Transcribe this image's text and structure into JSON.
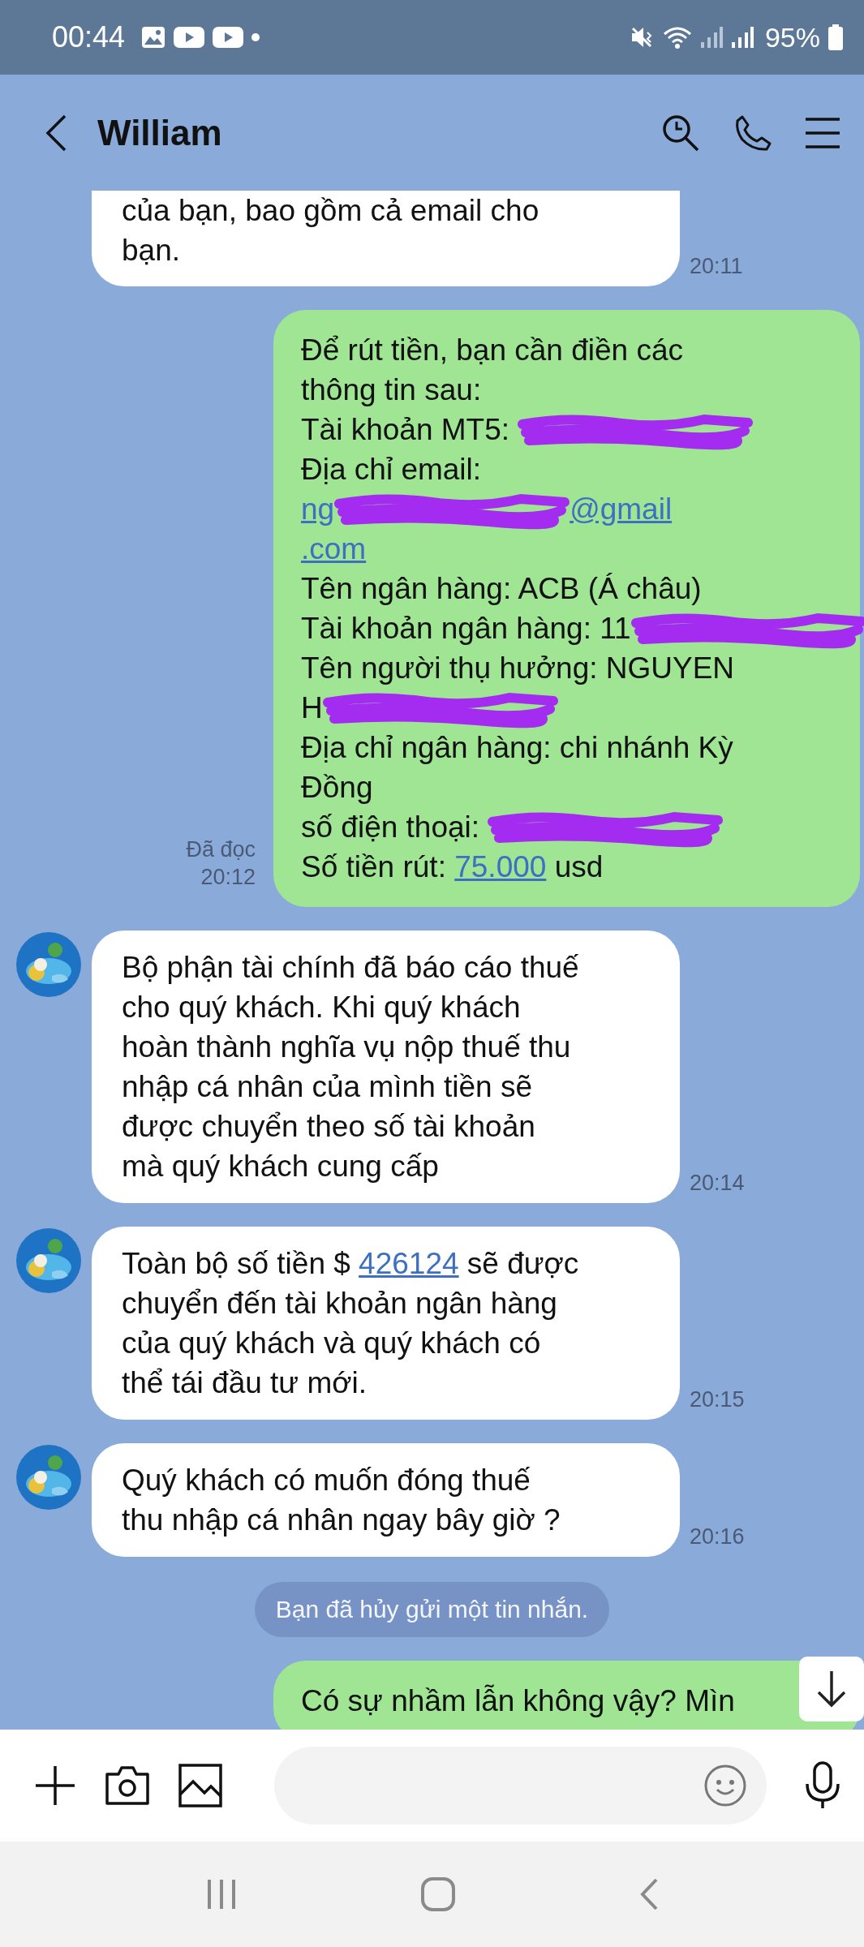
{
  "status_bar": {
    "time": "00:44",
    "battery": "95%"
  },
  "header": {
    "title": "William"
  },
  "messages": [
    {
      "kind": "incoming",
      "avatar": false,
      "time": "20:11",
      "lines": [
        [
          {
            "kind": "text",
            "text": "của bạn, bao gồm cả email cho"
          }
        ],
        [
          {
            "kind": "text",
            "text": "bạn."
          }
        ]
      ]
    },
    {
      "kind": "outgoing",
      "read": "Đã đọc",
      "time": "20:12",
      "lines": [
        [
          {
            "kind": "text",
            "text": "Để rút tiền, bạn cần điền các"
          }
        ],
        [
          {
            "kind": "text",
            "text": "thông tin sau:"
          }
        ],
        [
          {
            "kind": "text",
            "text": "Tài khoản MT5: "
          },
          {
            "kind": "redacted"
          }
        ],
        [
          {
            "kind": "text",
            "text": "Địa chỉ email:"
          }
        ],
        [
          {
            "kind": "link",
            "text": "ng"
          },
          {
            "kind": "redacted"
          },
          {
            "kind": "link",
            "text": "@gmail"
          }
        ],
        [
          {
            "kind": "link",
            "text": ".com"
          }
        ],
        [
          {
            "kind": "text",
            "text": "Tên ngân hàng: ACB (Á châu)"
          }
        ],
        [
          {
            "kind": "text",
            "text": "Tài khoản ngân hàng: 11"
          },
          {
            "kind": "redacted"
          }
        ],
        [
          {
            "kind": "text",
            "text": "Tên người thụ hưởng: NGUYEN"
          }
        ],
        [
          {
            "kind": "text",
            "text": "H"
          },
          {
            "kind": "redacted"
          }
        ],
        [
          {
            "kind": "text",
            "text": "Địa chỉ ngân hàng: chi nhánh Kỳ"
          }
        ],
        [
          {
            "kind": "text",
            "text": "Đồng"
          }
        ],
        [
          {
            "kind": "text",
            "text": "số điện thoại: "
          },
          {
            "kind": "redacted"
          }
        ],
        [
          {
            "kind": "text",
            "text": "Số tiền rút: "
          },
          {
            "kind": "link",
            "text": "75.000"
          },
          {
            "kind": "text",
            "text": " usd"
          }
        ]
      ]
    },
    {
      "kind": "incoming",
      "avatar": true,
      "time": "20:14",
      "lines": [
        [
          {
            "kind": "text",
            "text": "Bộ phận tài chính đã báo cáo thuế"
          }
        ],
        [
          {
            "kind": "text",
            "text": "cho quý khách. Khi quý khách"
          }
        ],
        [
          {
            "kind": "text",
            "text": "hoàn thành nghĩa vụ nộp thuế thu"
          }
        ],
        [
          {
            "kind": "text",
            "text": "nhập cá nhân của mình tiền sẽ"
          }
        ],
        [
          {
            "kind": "text",
            "text": "được chuyển theo số tài khoản"
          }
        ],
        [
          {
            "kind": "text",
            "text": "mà quý khách cung cấp"
          }
        ]
      ]
    },
    {
      "kind": "incoming",
      "avatar": true,
      "time": "20:15",
      "lines": [
        [
          {
            "kind": "text",
            "text": "Toàn bộ số tiền $ "
          },
          {
            "kind": "link",
            "text": "426124"
          },
          {
            "kind": "text",
            "text": " sẽ được"
          }
        ],
        [
          {
            "kind": "text",
            "text": "chuyển đến tài khoản ngân hàng"
          }
        ],
        [
          {
            "kind": "text",
            "text": "của quý khách và quý khách có"
          }
        ],
        [
          {
            "kind": "text",
            "text": "thể tái đầu tư mới."
          }
        ]
      ]
    },
    {
      "kind": "incoming",
      "avatar": true,
      "time": "20:16",
      "lines": [
        [
          {
            "kind": "text",
            "text": "Quý khách có muốn đóng thuế"
          }
        ],
        [
          {
            "kind": "text",
            "text": "thu nhập cá nhân ngay bây giờ ?"
          }
        ]
      ]
    },
    {
      "kind": "notice",
      "text": "Bạn đã hủy gửi một tin nhắn."
    },
    {
      "kind": "outgoing",
      "lines": [
        [
          {
            "kind": "text",
            "text": "Có sự nhầm lẫn không vậy? Mìn"
          }
        ]
      ]
    }
  ]
}
